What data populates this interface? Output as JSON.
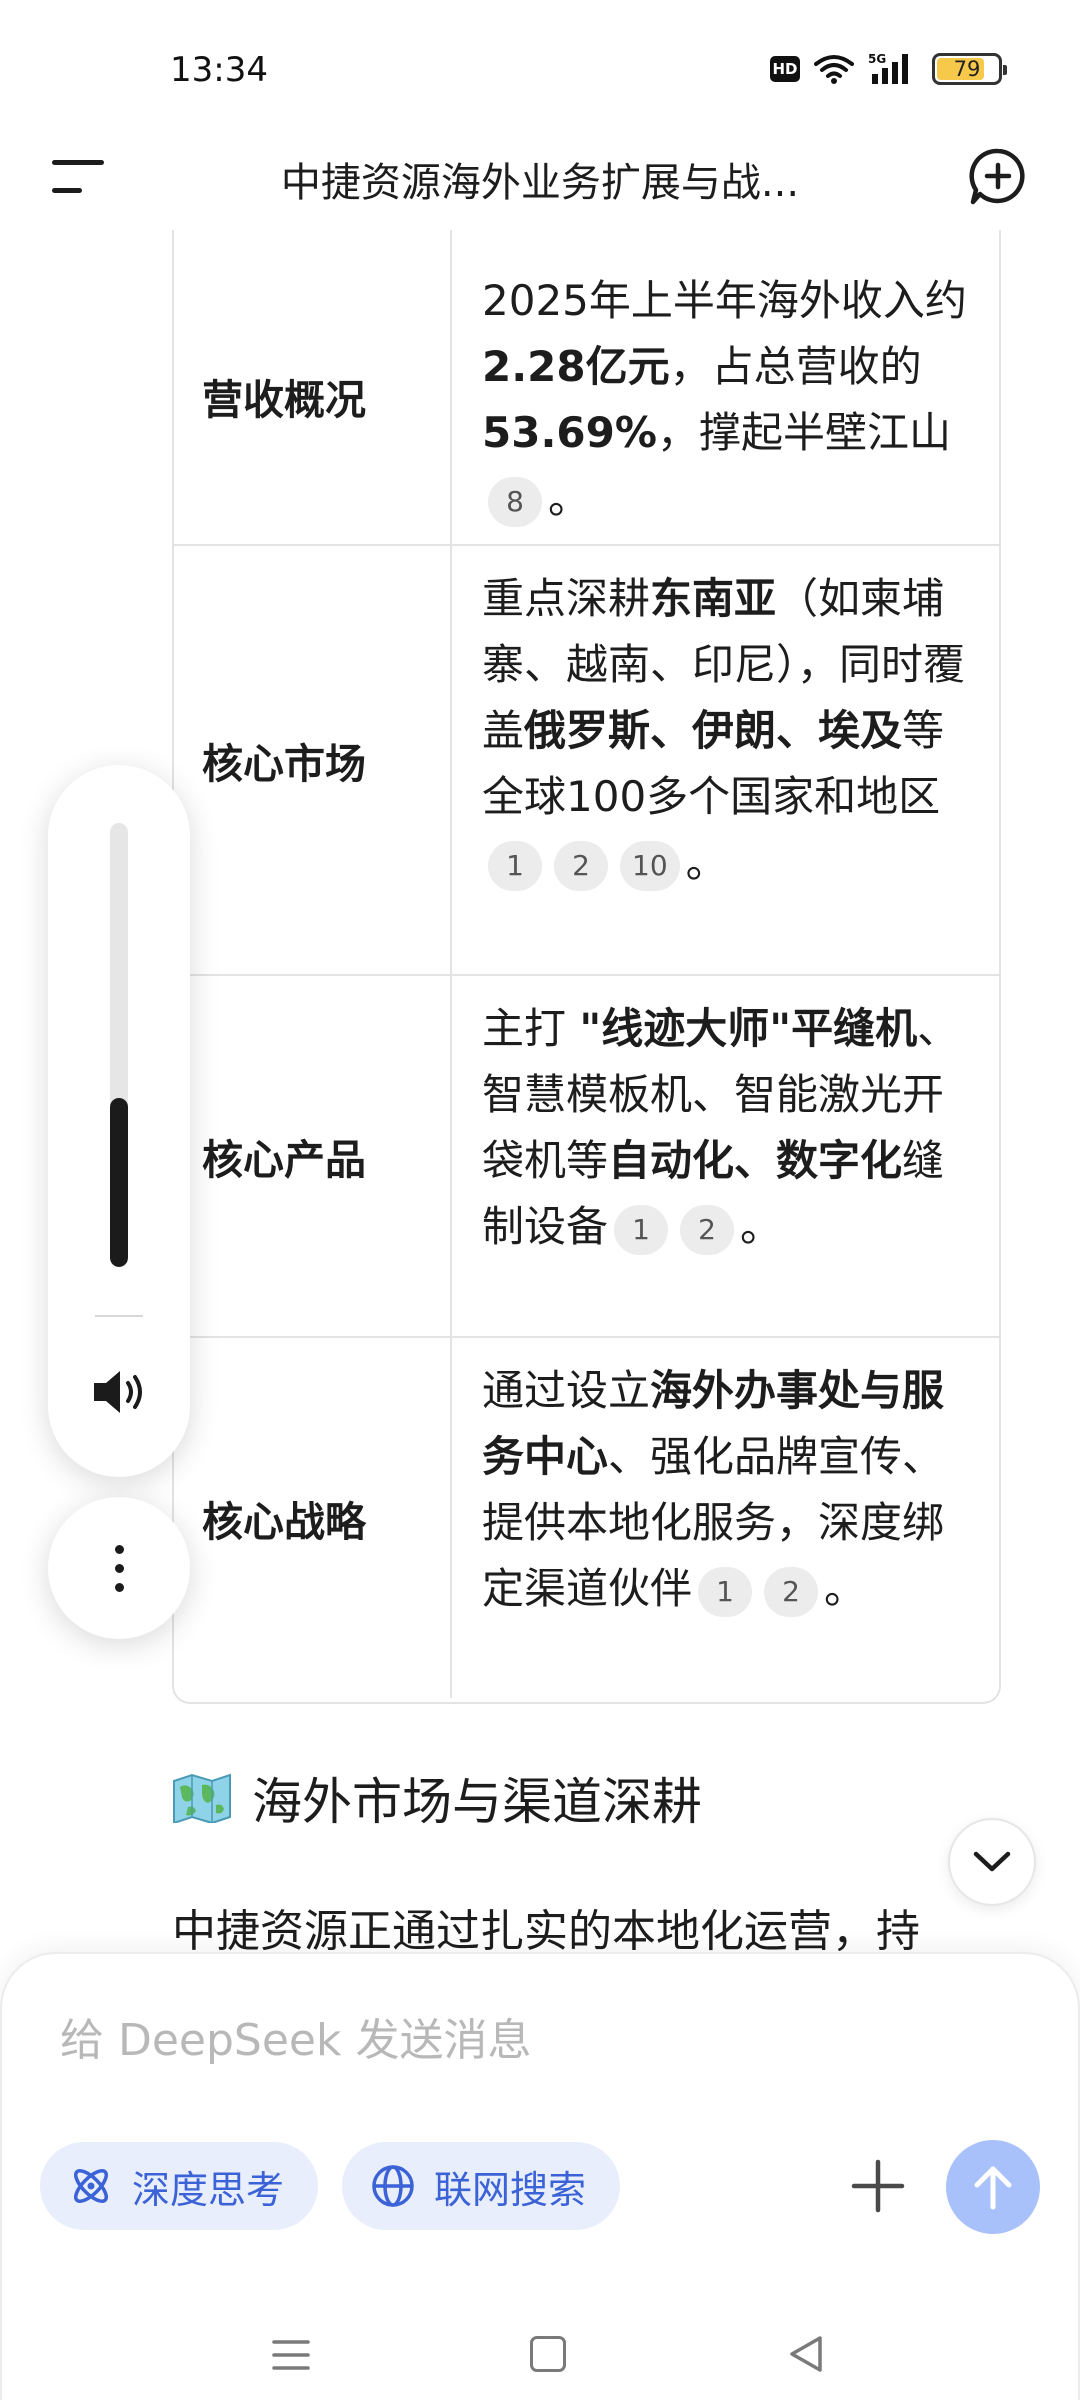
{
  "status_bar": {
    "time": "13:34",
    "battery": "79",
    "battery_level": 0.79,
    "network": "5G",
    "icons": [
      "hd-icon",
      "wifi-icon",
      "signal-5g-icon",
      "battery-icon"
    ]
  },
  "header": {
    "title": "中捷资源海外业务扩展与战...",
    "menu_icon": "menu-icon",
    "new_chat_icon": "new-chat-icon"
  },
  "table": {
    "rows": [
      {
        "label": "营收概况",
        "segments": [
          {
            "text": "2025年上半年海外收入约"
          },
          {
            "text": "2.28亿元",
            "bold": true
          },
          {
            "text": "，占总营收的"
          },
          {
            "text": "53.69%",
            "bold": true
          },
          {
            "text": "，撑起半壁江山"
          },
          {
            "cite": "8"
          },
          {
            "text": "。"
          }
        ]
      },
      {
        "label": "核心市场",
        "segments": [
          {
            "text": "重点深耕"
          },
          {
            "text": "东南亚",
            "bold": true
          },
          {
            "text": "（如柬埔寨、越南、印尼），同时覆盖"
          },
          {
            "text": "俄罗斯、伊朗、埃及",
            "bold": true
          },
          {
            "text": "等全球100多个国家和地区"
          },
          {
            "cite": "1"
          },
          {
            "cite": "2"
          },
          {
            "cite": "10"
          },
          {
            "text": "。"
          }
        ]
      },
      {
        "label": "核心产品",
        "segments": [
          {
            "text": "主打 "
          },
          {
            "text": "\"线迹大师\"平缝机",
            "bold": true
          },
          {
            "text": "、智慧模板机、智能激光开袋机等"
          },
          {
            "text": "自动化、数字化",
            "bold": true
          },
          {
            "text": "缝制设备"
          },
          {
            "cite": "1"
          },
          {
            "cite": "2"
          },
          {
            "text": "。"
          }
        ]
      },
      {
        "label": "核心战略",
        "segments": [
          {
            "text": "通过设立"
          },
          {
            "text": "海外办事处与服务中心",
            "bold": true
          },
          {
            "text": "、强化品牌宣传、提供本地化服务，深度绑定渠道伙伴"
          },
          {
            "cite": "1"
          },
          {
            "cite": "2"
          },
          {
            "text": "。"
          }
        ]
      }
    ]
  },
  "section": {
    "icon": "world-map-icon",
    "heading": "海外市场与渠道深耕",
    "text": "中捷资源正通过扎实的本地化运营，持"
  },
  "volume_overlay": {
    "level": 0.38,
    "speaker_icon": "speaker-icon",
    "more_icon": "more-vertical-icon"
  },
  "composer": {
    "placeholder": "给 DeepSeek 发送消息",
    "value": "",
    "deep_think_label": "深度思考",
    "web_search_label": "联网搜索",
    "accent_color": "#3b62d6",
    "send_color": "#a9c1fa"
  },
  "nav_bar": {
    "icons": [
      "recents-icon",
      "home-icon",
      "back-icon"
    ]
  }
}
